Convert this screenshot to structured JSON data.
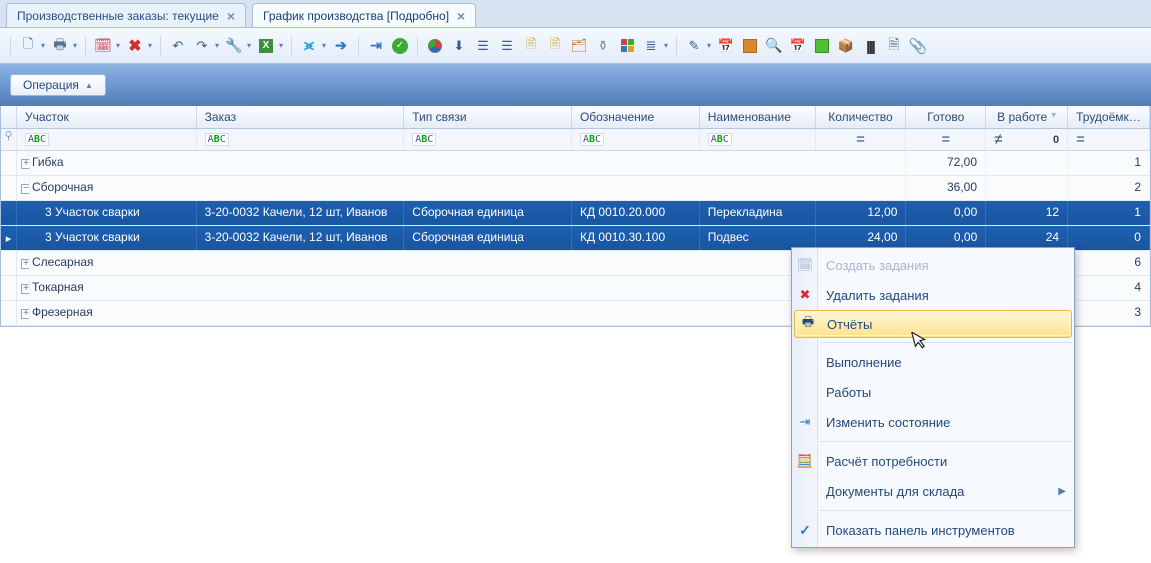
{
  "tabs": {
    "t0": {
      "label": "Производственные заказы: текущие"
    },
    "t1": {
      "label": "График производства [Подробно]"
    }
  },
  "opbar": {
    "label": "Операция"
  },
  "columns": {
    "uchastok": "Участок",
    "zakaz": "Заказ",
    "tip": "Тип связи",
    "oboz": "Обозначение",
    "naim": "Наименование",
    "kol": "Количество",
    "gotovo": "Готово",
    "vrab": "В работе",
    "trud": "Трудоёмкость"
  },
  "filter": {
    "abc": "A B C",
    "zero": "0",
    "eq": "=",
    "neq": "≠"
  },
  "groups": {
    "g0": {
      "name": "Гибка",
      "gotovo": "72,00",
      "trud": "1"
    },
    "g1": {
      "name": "Сборочная",
      "gotovo": "36,00",
      "trud": "2"
    },
    "g2": {
      "name": "Слесарная",
      "trud": "6"
    },
    "g3": {
      "name": "Токарная",
      "trud": "4"
    },
    "g4": {
      "name": "Фрезерная",
      "trud": "3"
    }
  },
  "rows": {
    "r0": {
      "uch": "3 Участок  сварки",
      "zakaz": "3-20-0032 Качели, 12 шт, Иванов",
      "tip": "Сборочная единица",
      "oboz": "КД 0010.20.000",
      "naim": "Перекладина",
      "kol": "12,00",
      "gotovo": "0,00",
      "vrab": "12",
      "trud": "1"
    },
    "r1": {
      "uch": "3 Участок  сварки",
      "zakaz": "3-20-0032 Качели, 12 шт, Иванов",
      "tip": "Сборочная единица",
      "oboz": "КД 0010.30.100",
      "naim": "Подвес",
      "kol": "24,00",
      "gotovo": "0,00",
      "vrab": "24",
      "trud": "0"
    }
  },
  "menu": {
    "m0": "Создать задания",
    "m1": "Удалить задания",
    "m2": "Отчёты",
    "m3": "Выполнение",
    "m4": "Работы",
    "m5": "Изменить состояние",
    "m6": "Расчёт потребности",
    "m7": "Документы для склада",
    "m8": "Показать панель инструментов"
  }
}
